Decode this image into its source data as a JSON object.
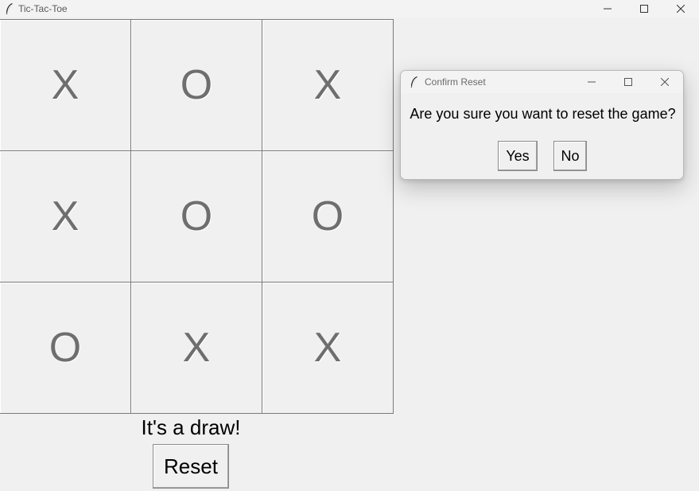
{
  "window": {
    "title": "Tic-Tac-Toe",
    "icon": "feather-icon"
  },
  "board": {
    "cells": [
      "X",
      "O",
      "X",
      "X",
      "O",
      "O",
      "O",
      "X",
      "X"
    ]
  },
  "status": "It's a draw!",
  "reset_label": "Reset",
  "dialog": {
    "title": "Confirm Reset",
    "icon": "feather-icon",
    "message": "Are you sure you want to reset the game?",
    "yes_label": "Yes",
    "no_label": "No"
  },
  "colors": {
    "background": "#f0f0f0",
    "mark": "#6e6e6e",
    "grid": "#7a7a7a"
  }
}
